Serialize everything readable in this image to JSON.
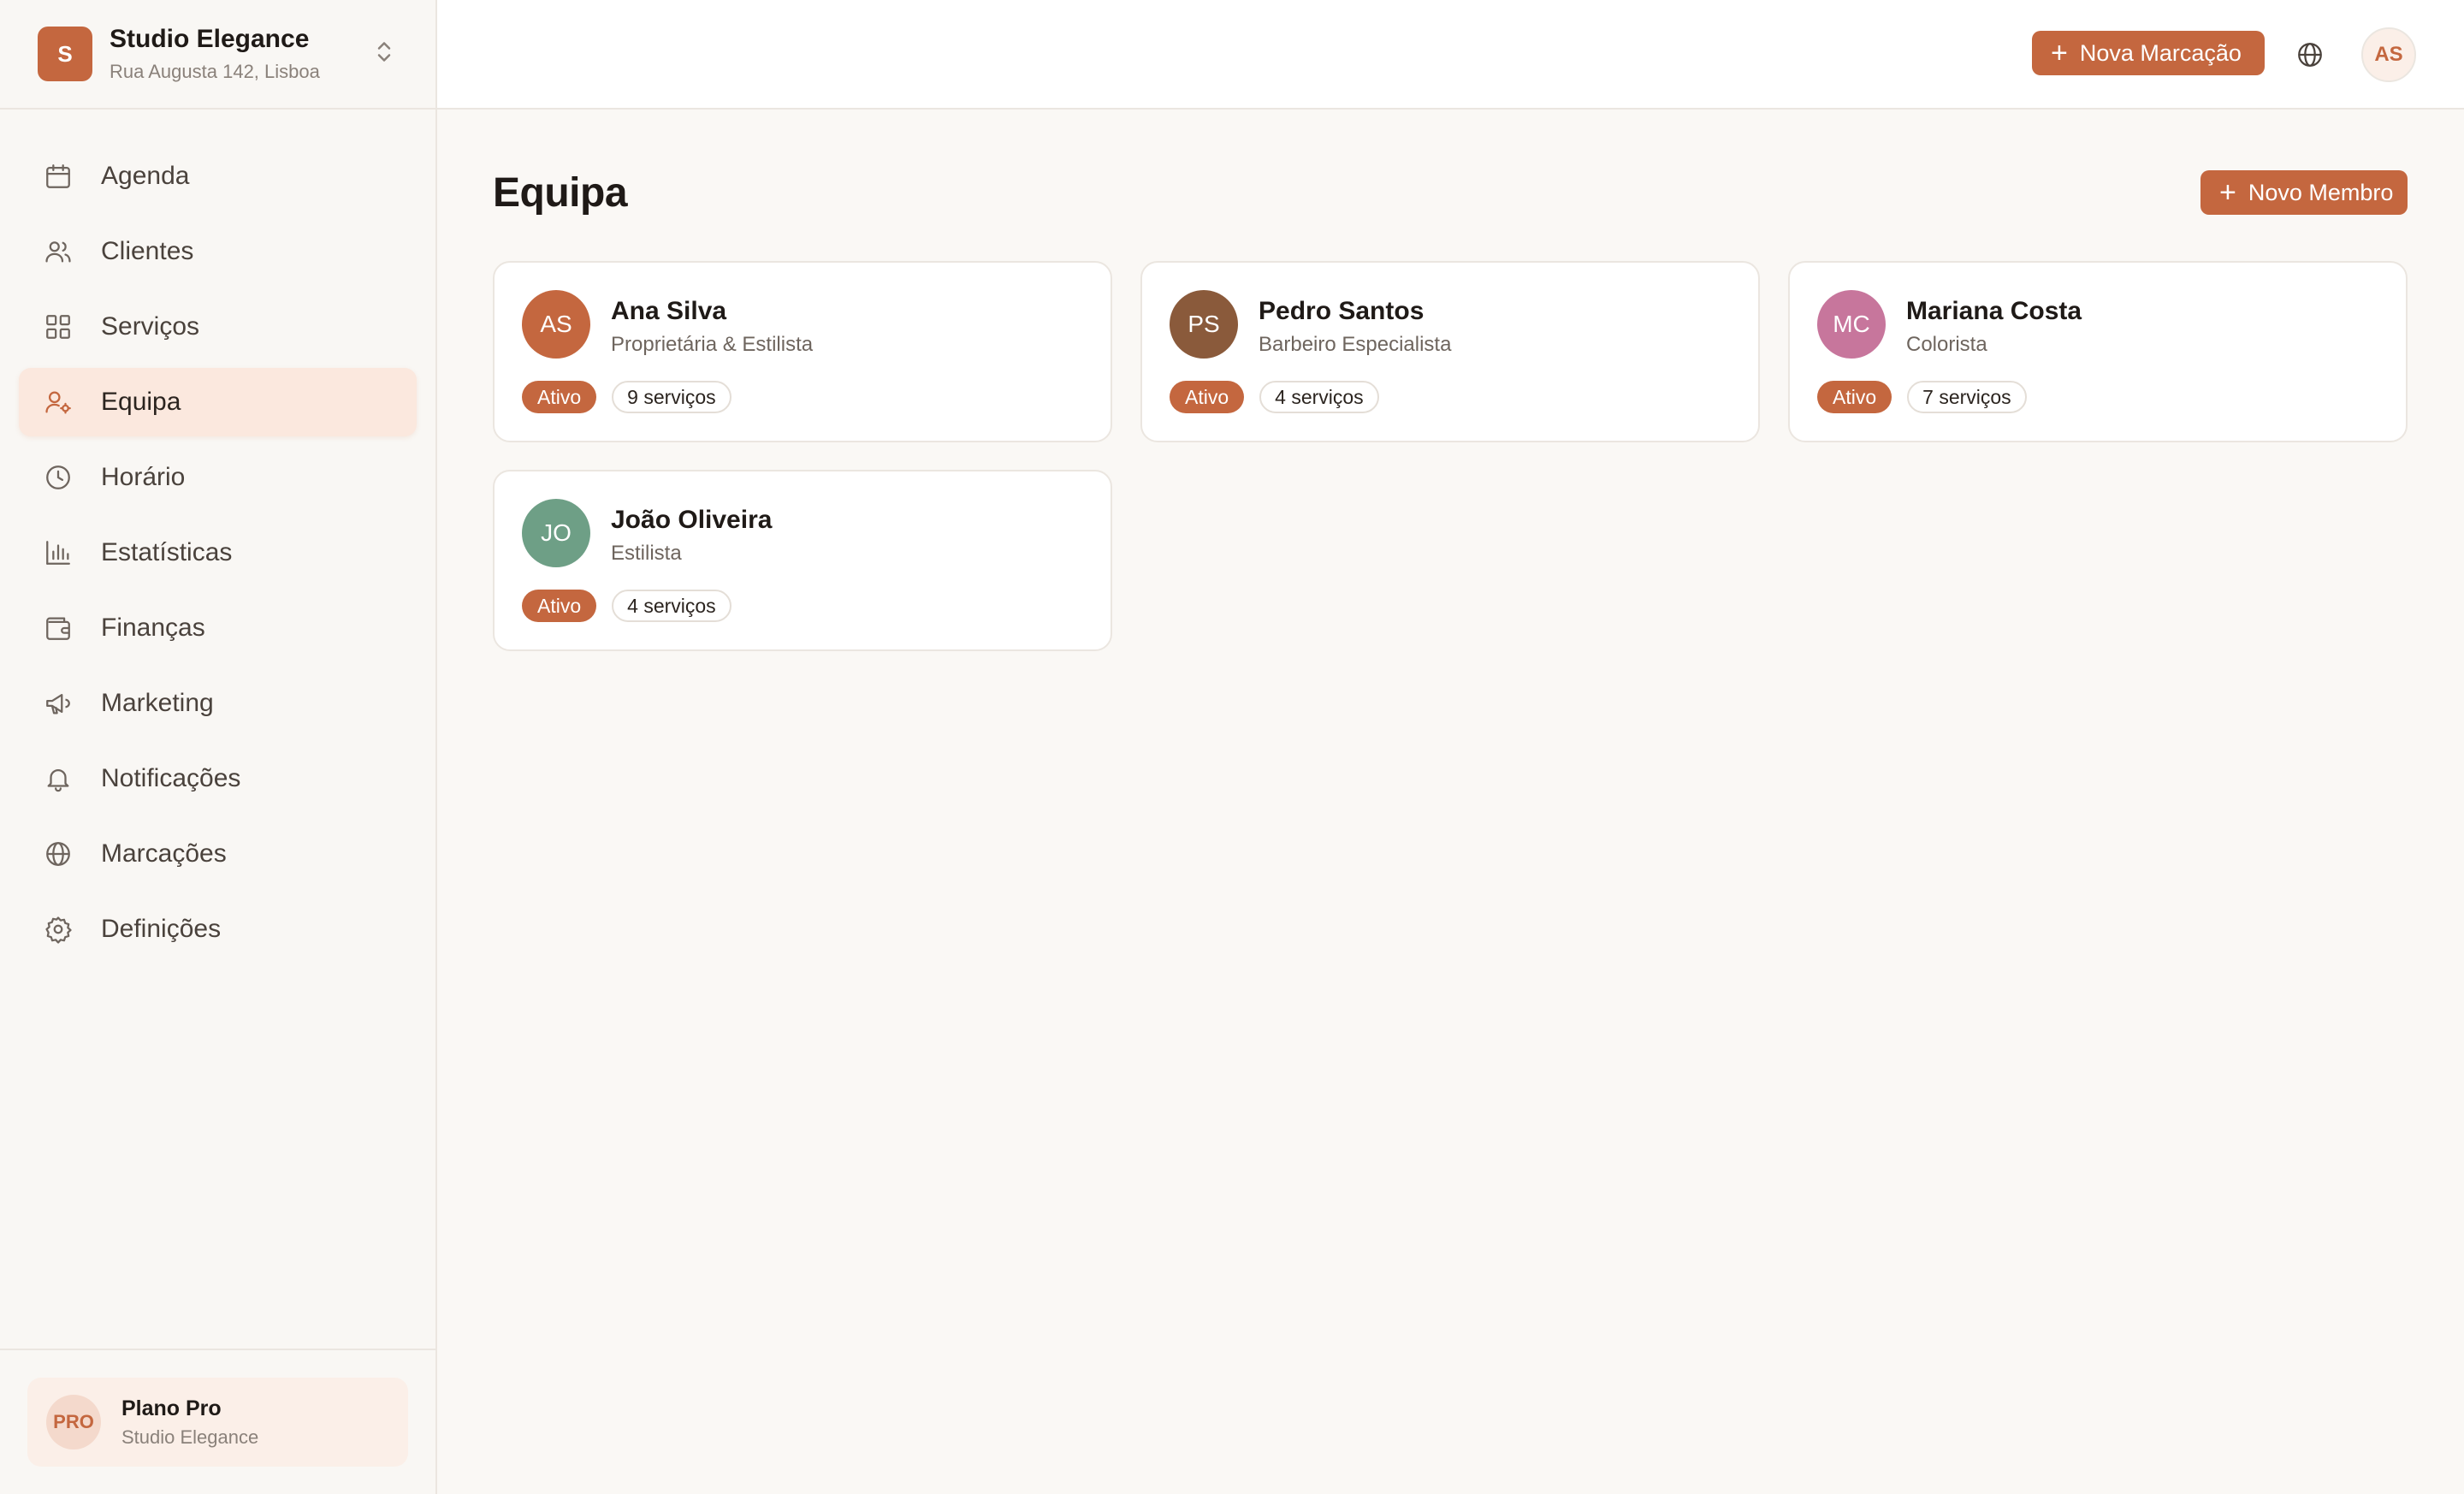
{
  "org": {
    "logo_letter": "S",
    "name": "Studio Elegance",
    "address": "Rua Augusta 142, Lisboa"
  },
  "nav": [
    {
      "label": "Agenda",
      "icon": "calendar-icon"
    },
    {
      "label": "Clientes",
      "icon": "users-icon"
    },
    {
      "label": "Serviços",
      "icon": "grid-icon"
    },
    {
      "label": "Equipa",
      "icon": "user-cog-icon",
      "active": true
    },
    {
      "label": "Horário",
      "icon": "clock-icon"
    },
    {
      "label": "Estatísticas",
      "icon": "bar-chart-icon"
    },
    {
      "label": "Finanças",
      "icon": "wallet-icon"
    },
    {
      "label": "Marketing",
      "icon": "megaphone-icon"
    },
    {
      "label": "Notificações",
      "icon": "bell-icon"
    },
    {
      "label": "Marcações",
      "icon": "globe-icon"
    },
    {
      "label": "Definições",
      "icon": "gear-icon"
    }
  ],
  "plan": {
    "badge": "PRO",
    "title": "Plano Pro",
    "subtitle": "Studio Elegance"
  },
  "topbar": {
    "new_booking_label": "Nova Marcação",
    "user_initials": "AS"
  },
  "page": {
    "title": "Equipa",
    "new_member_label": "Novo Membro"
  },
  "team": [
    {
      "initials": "AS",
      "name": "Ana Silva",
      "role": "Proprietária & Estilista",
      "status": "Ativo",
      "services": "9 serviços",
      "color": "#c4673f"
    },
    {
      "initials": "PS",
      "name": "Pedro Santos",
      "role": "Barbeiro Especialista",
      "status": "Ativo",
      "services": "4 serviços",
      "color": "#8a5a3b"
    },
    {
      "initials": "MC",
      "name": "Mariana Costa",
      "role": "Colorista",
      "status": "Ativo",
      "services": "7 serviços",
      "color": "#c7769c"
    },
    {
      "initials": "JO",
      "name": "João Oliveira",
      "role": "Estilista",
      "status": "Ativo",
      "services": "4 serviços",
      "color": "#6e9f86"
    }
  ],
  "colors": {
    "accent": "#c4673f",
    "active_nav_bg": "#fbe8de"
  }
}
